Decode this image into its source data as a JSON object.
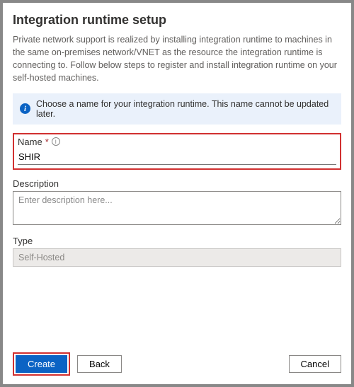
{
  "title": "Integration runtime setup",
  "intro": "Private network support is realized by installing integration runtime to machines in the same on-premises network/VNET as the resource the integration runtime is connecting to. Follow below steps to register and install integration runtime on your self-hosted machines.",
  "info": "Choose a name for your integration runtime. This name cannot be updated later.",
  "form": {
    "name_label": "Name",
    "name_required_mark": "*",
    "name_value": "SHIR",
    "desc_label": "Description",
    "desc_placeholder": "Enter description here...",
    "desc_value": "",
    "type_label": "Type",
    "type_value": "Self-Hosted"
  },
  "buttons": {
    "create": "Create",
    "back": "Back",
    "cancel": "Cancel"
  }
}
